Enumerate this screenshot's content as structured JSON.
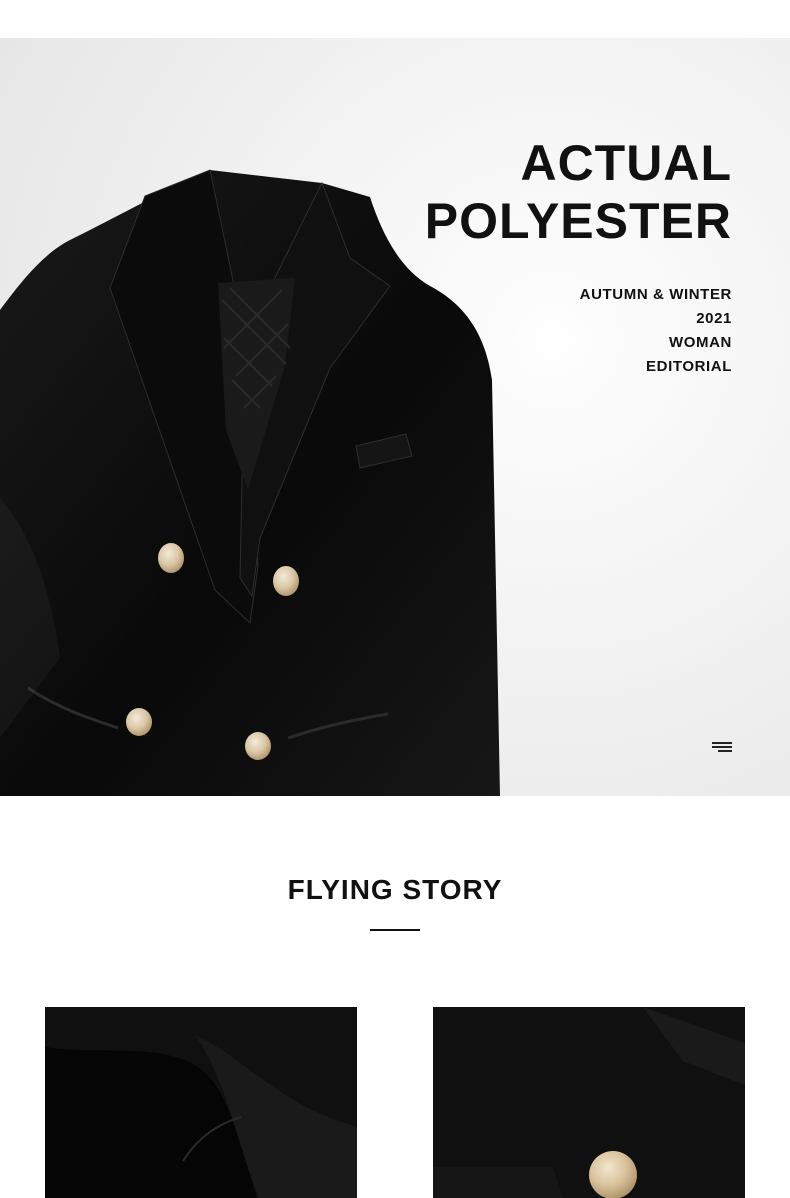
{
  "hero": {
    "title_line1": "ACTUAL",
    "title_line2": "POLYESTER",
    "subtitle": {
      "line1": "AUTUMN & WINTER",
      "line2": "2021",
      "line3": "WOMAN",
      "line4": "EDITORIAL"
    },
    "image_subject": "black double-breasted blazer"
  },
  "section": {
    "title": "FLYING STORY"
  },
  "details": [
    {
      "image_subject": "black wool sleeve detail"
    },
    {
      "image_subject": "black blazer front with gold button"
    }
  ],
  "icons": {
    "menu": "menu-icon"
  },
  "colors": {
    "background": "#ffffff",
    "text": "#111111",
    "fabric": "#111111",
    "button_gold": "#d8c4a3"
  }
}
